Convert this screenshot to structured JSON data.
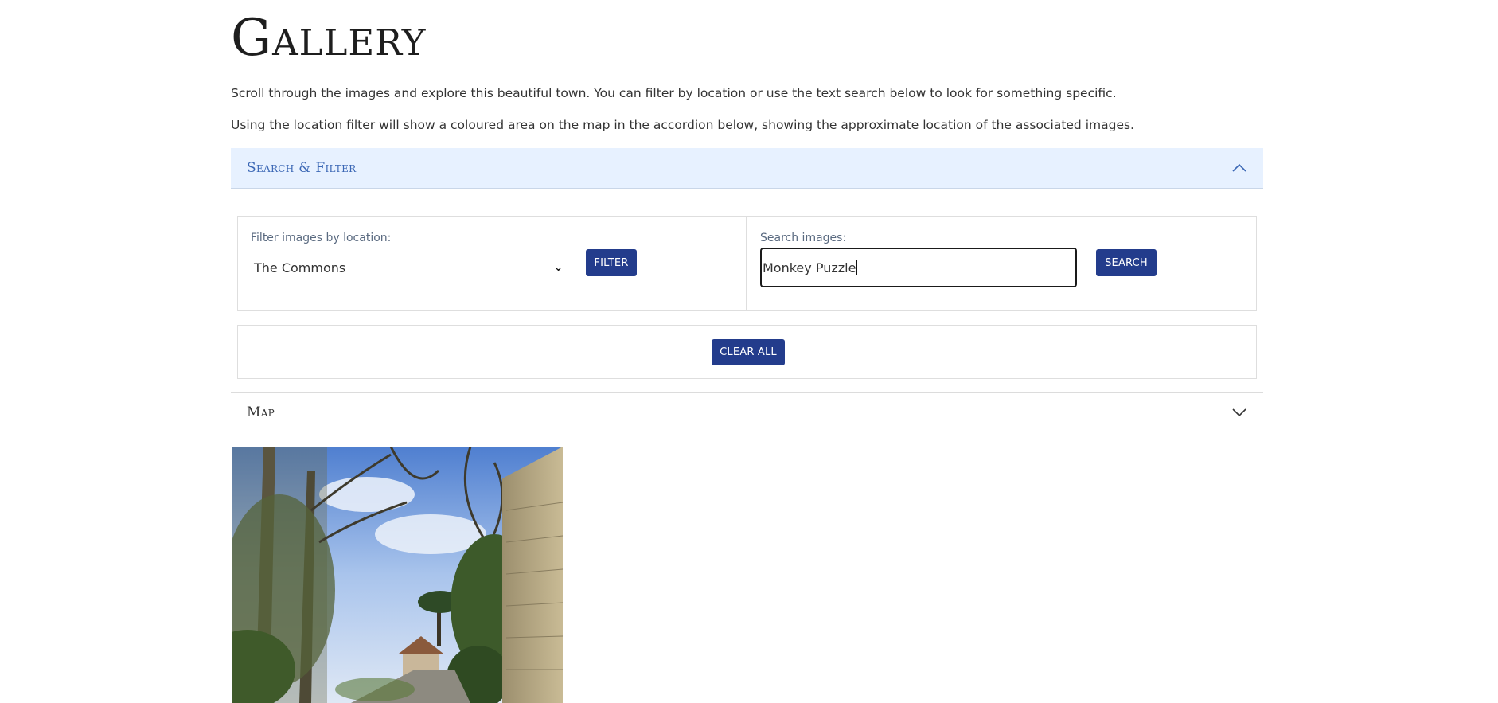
{
  "page": {
    "title": "Gallery",
    "intro_1": "Scroll through the images and explore this beautiful town. You can filter by location or use the text search below to look for something specific.",
    "intro_2": "Using the location filter will show a coloured area on the map in the accordion below, showing the approximate location of the associated images."
  },
  "search_filter": {
    "header": "Search & Filter",
    "expanded": true,
    "location_label": "Filter images by location:",
    "location_selected": "The Commons",
    "filter_button": "FILTER",
    "search_label": "Search images:",
    "search_value": "Monkey Puzzle",
    "search_button": "SEARCH",
    "clear_button": "CLEAR ALL"
  },
  "map_section": {
    "header": "Map",
    "expanded": false
  },
  "gallery": {
    "items": [
      {
        "icon": "photo-lane-trees-stone-wall"
      }
    ]
  },
  "colors": {
    "accent": "#233c8c",
    "accordion_active_bg": "#e7f1ff",
    "accordion_active_text": "#3b67b5"
  }
}
